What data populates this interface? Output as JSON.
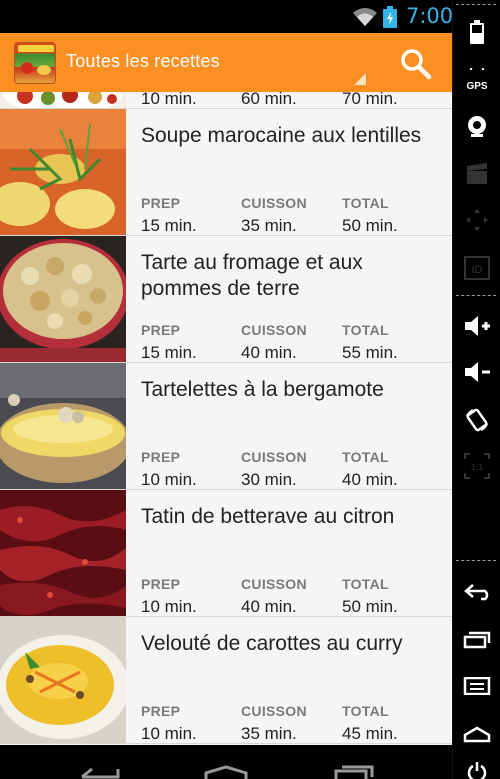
{
  "status_bar": {
    "time": "7:00"
  },
  "action_bar": {
    "title": "Toutes les recettes",
    "accent_color": "#fb8f22"
  },
  "labels": {
    "prep": "PREP",
    "cuisson": "CUISSON",
    "total": "TOTAL"
  },
  "recipes": [
    {
      "title": "",
      "prep": "10 min.",
      "cuisson": "60 min.",
      "total": "70 min."
    },
    {
      "title": "Soupe marocaine aux lentilles",
      "prep": "15 min.",
      "cuisson": "35 min.",
      "total": "50 min."
    },
    {
      "title": "Tarte au fromage et aux pommes de terre",
      "prep": "15 min.",
      "cuisson": "40 min.",
      "total": "55 min."
    },
    {
      "title": "Tartelettes à la bergamote",
      "prep": "10 min.",
      "cuisson": "30 min.",
      "total": "40 min."
    },
    {
      "title": "Tatin de betterave au citron",
      "prep": "10 min.",
      "cuisson": "40 min.",
      "total": "50 min."
    },
    {
      "title": "Velouté de carottes au curry",
      "prep": "10 min.",
      "cuisson": "35 min.",
      "total": "45 min."
    }
  ],
  "side_panel": {
    "gps_label": "GPS",
    "id_label": "ID",
    "scale_label": "1:1"
  }
}
